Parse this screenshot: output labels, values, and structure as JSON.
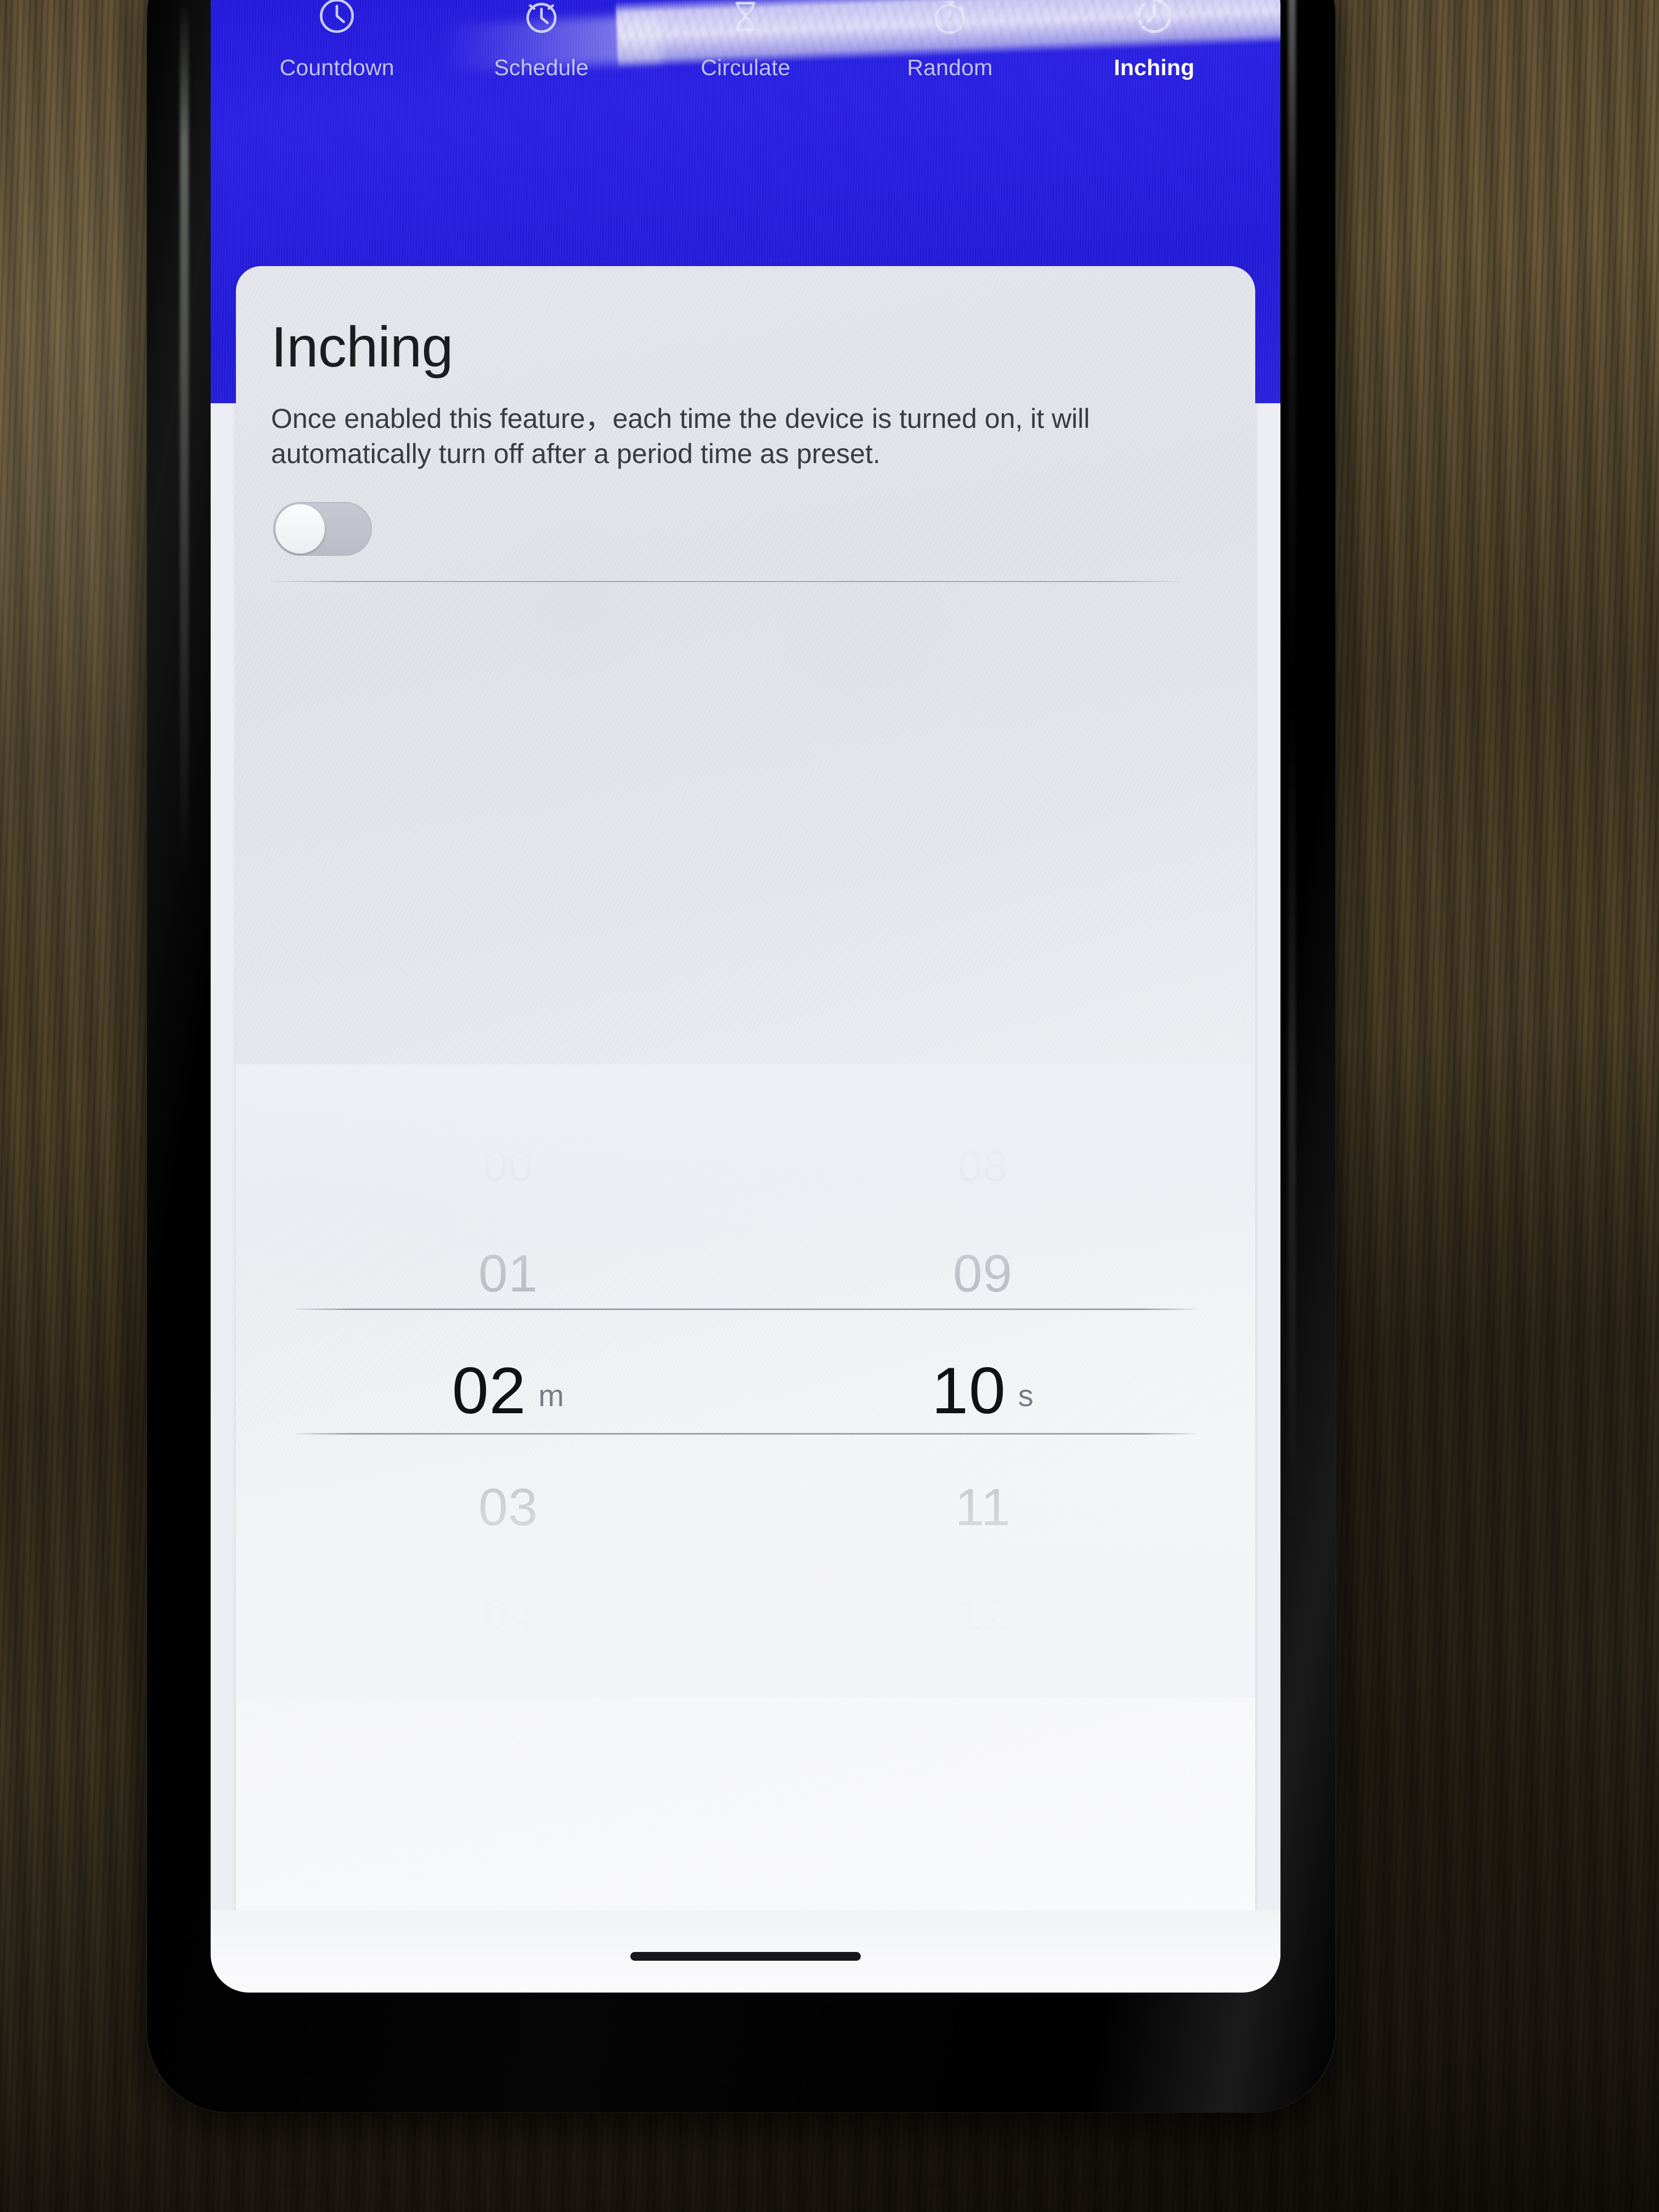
{
  "app": {
    "header_color": "#2018dc",
    "sheet_color": "#eceef2"
  },
  "tabs": [
    {
      "label": "Countdown",
      "icon": "clock-icon",
      "active": false
    },
    {
      "label": "Schedule",
      "icon": "alarm-clock-icon",
      "active": false
    },
    {
      "label": "Circulate",
      "icon": "hourglass-icon",
      "active": false
    },
    {
      "label": "Random",
      "icon": "stopwatch-icon",
      "active": false
    },
    {
      "label": "Inching",
      "icon": "inching-clock-icon",
      "active": true
    }
  ],
  "sheet": {
    "title": "Inching",
    "description": "Once enabled this feature，each time the device is turned on, it will automatically turn off after a period time as preset.",
    "toggle": {
      "name": "inching-enable-toggle",
      "state": "off",
      "state_label": "Off"
    }
  },
  "time_picker": {
    "minutes": {
      "unit": "m",
      "selected": "02",
      "above_far": "00",
      "above_near": "01",
      "below_near": "03",
      "below_far": "04"
    },
    "seconds": {
      "unit": "s",
      "selected": "10",
      "above_far": "08",
      "above_near": "09",
      "below_near": "11",
      "below_far": "12"
    }
  }
}
